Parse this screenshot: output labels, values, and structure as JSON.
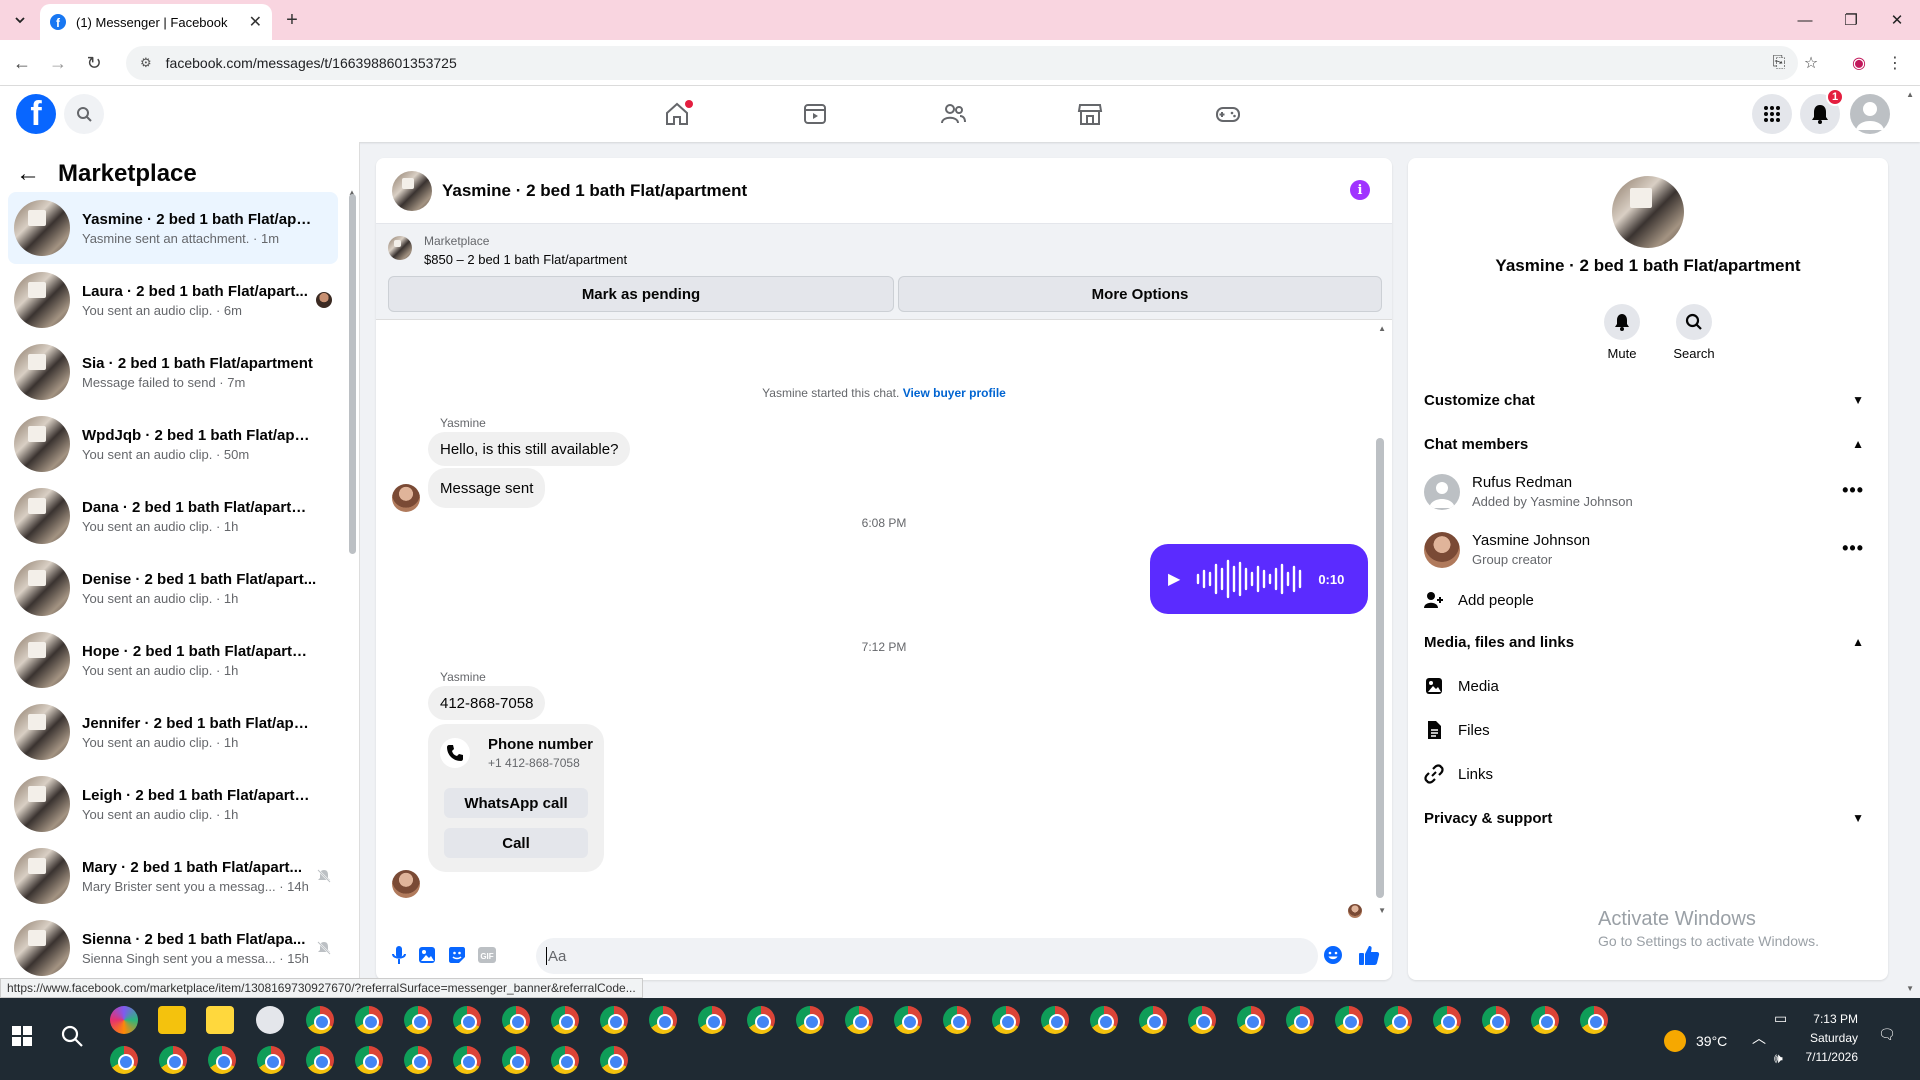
{
  "browser": {
    "tab_title": "(1) Messenger | Facebook",
    "url": "facebook.com/messages/t/1663988601353725",
    "status_url": "https://www.facebook.com/marketplace/item/1308169730927670/?referralSurface=messenger_banner&referralCode..."
  },
  "header": {
    "notification_count": "1"
  },
  "sidebar": {
    "title": "Marketplace",
    "conversations": [
      {
        "name": "Yasmine · 2 bed 1 bath Flat/apar...",
        "sub": "Yasmine sent an attachment. · 1m"
      },
      {
        "name": "Laura · 2 bed 1 bath Flat/apart...",
        "sub": "You sent an audio clip. · 6m"
      },
      {
        "name": "Sia · 2 bed 1 bath Flat/apartment",
        "sub": "Message failed to send · 7m"
      },
      {
        "name": "WpdJqb · 2 bed 1 bath Flat/apar...",
        "sub": "You sent an audio clip. · 50m"
      },
      {
        "name": "Dana · 2 bed 1 bath Flat/apartm...",
        "sub": "You sent an audio clip. · 1h"
      },
      {
        "name": "Denise · 2 bed 1 bath Flat/apart...",
        "sub": "You sent an audio clip. · 1h"
      },
      {
        "name": "Hope · 2 bed 1 bath Flat/apartm...",
        "sub": "You sent an audio clip. · 1h"
      },
      {
        "name": "Jennifer · 2 bed 1 bath Flat/apart...",
        "sub": "You sent an audio clip. · 1h"
      },
      {
        "name": "Leigh · 2 bed 1 bath Flat/apartm...",
        "sub": "You sent an audio clip. · 1h"
      },
      {
        "name": "Mary · 2 bed 1 bath Flat/apart...",
        "sub": "Mary Brister sent you a messag... · 14h"
      },
      {
        "name": "Sienna · 2 bed 1 bath Flat/apa...",
        "sub": "Sienna Singh sent you a messa... · 15h"
      }
    ]
  },
  "chat": {
    "title": "Yasmine · 2 bed 1 bath Flat/apartment",
    "banner": {
      "label": "Marketplace",
      "price": "$850 – 2 bed 1 bath Flat/apartment",
      "btn_pending": "Mark as pending",
      "btn_more": "More Options"
    },
    "system_text": "Yasmine started this chat.",
    "system_link": "View buyer profile",
    "sender1": "Yasmine",
    "msg1": "Hello, is this still available?",
    "msg2": "Message sent",
    "time1": "6:08 PM",
    "audio_duration": "0:10",
    "time2": "7:12 PM",
    "sender2": "Yasmine",
    "msg3": "412-868-7058",
    "phone_title": "Phone number",
    "phone_number": "+1 412-868-7058",
    "btn_whatsapp": "WhatsApp call",
    "btn_call": "Call",
    "input_placeholder": "Aa"
  },
  "rpanel": {
    "name": "Yasmine · 2 bed 1 bath Flat/apartment",
    "mute": "Mute",
    "search": "Search",
    "customize": "Customize chat",
    "members_title": "Chat members",
    "members": [
      {
        "name": "Rufus Redman",
        "sub": "Added by Yasmine Johnson"
      },
      {
        "name": "Yasmine Johnson",
        "sub": "Group creator"
      }
    ],
    "add_people": "Add people",
    "media_title": "Media, files and links",
    "media": "Media",
    "files": "Files",
    "links": "Links",
    "privacy": "Privacy & support",
    "watermark1": "Activate Windows",
    "watermark2": "Go to Settings to activate Windows."
  },
  "taskbar": {
    "temperature": "39°C",
    "time": "7:13 PM",
    "day": "Saturday",
    "date": "7/11/2026"
  },
  "colors": {
    "fb_blue": "#0866ff",
    "audio_purple": "#5b2bff",
    "info_purple": "#a033ff",
    "active_conv": "#ebf5ff"
  }
}
